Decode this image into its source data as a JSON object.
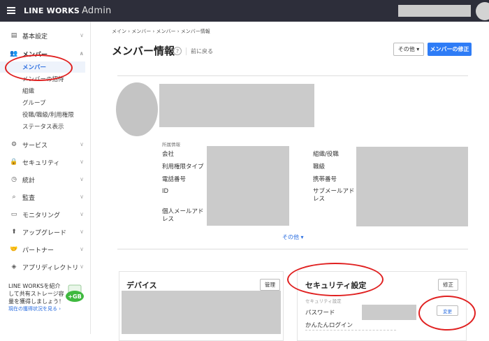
{
  "header": {
    "logo": "LINE WORKS",
    "product": "Admin"
  },
  "sidebar": {
    "items": [
      {
        "label": "基本設定",
        "icon": "building-icon"
      },
      {
        "label": "メンバー",
        "icon": "people-icon",
        "expanded": true,
        "children": [
          {
            "label": "メンバー",
            "active": true
          },
          {
            "label": "メンバーの招待"
          },
          {
            "label": "組織"
          },
          {
            "label": "グループ"
          },
          {
            "label": "役職/職級/利用権限"
          },
          {
            "label": "ステータス表示"
          }
        ]
      },
      {
        "label": "サービス",
        "icon": "gear-icon"
      },
      {
        "label": "セキュリティ",
        "icon": "lock-icon"
      },
      {
        "label": "統計",
        "icon": "clock-icon"
      },
      {
        "label": "監査",
        "icon": "search-doc-icon"
      },
      {
        "label": "モニタリング",
        "icon": "monitor-icon"
      },
      {
        "label": "アップグレード",
        "icon": "upgrade-icon"
      },
      {
        "label": "パートナー",
        "icon": "handshake-icon"
      },
      {
        "label": "アプリディレクトリ",
        "icon": "layers-icon"
      }
    ],
    "promo": {
      "text": "LINE WORKSを紹介して共有ストレージ容量を獲得しましょう！",
      "link": "現在の獲得状況を見る ›",
      "badge": "+GB"
    }
  },
  "breadcrumb": "メイン  ›  メンバー  ›  メンバー  ›  メンバー情報",
  "page": {
    "title": "メンバー情報",
    "help": "?",
    "back": "前に戻る"
  },
  "actions": {
    "other": "その他 ▾",
    "edit": "メンバーの修正"
  },
  "profile": {
    "section_label": "所属情報",
    "left_fields": [
      "会社",
      "利用権限タイプ",
      "電話番号",
      "ID",
      "個人メールアドレス"
    ],
    "right_fields": [
      "組織/役職",
      "職級",
      "携帯番号",
      "サブメールアドレス"
    ],
    "more": "その他 ▾"
  },
  "devices": {
    "title": "デバイス",
    "manage": "管理"
  },
  "security": {
    "title": "セキュリティ設定",
    "edit": "修正",
    "sub_label": "セキュリティ設定",
    "password_label": "パスワード",
    "easy_login_label": "かんたんログイン",
    "change": "変更"
  },
  "colors": {
    "accent": "#2e7cf6",
    "topbar": "#2d2e3a",
    "annotation": "#e02020"
  }
}
